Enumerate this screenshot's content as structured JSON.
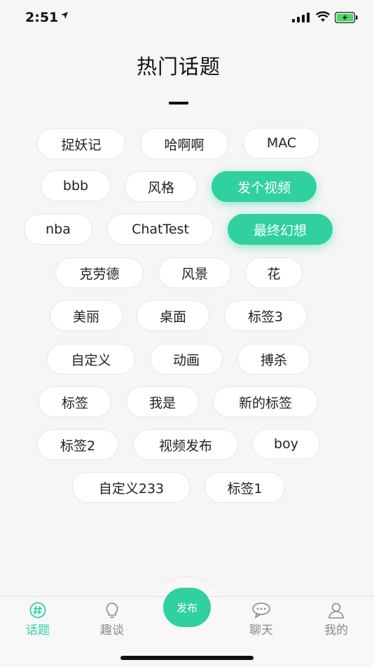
{
  "status": {
    "time": "2:51"
  },
  "page": {
    "title": "热门话题"
  },
  "tags": [
    {
      "label": "捉妖记",
      "active": false
    },
    {
      "label": "哈啊啊",
      "active": false
    },
    {
      "label": "MAC",
      "active": false
    },
    {
      "label": "bbb",
      "active": false
    },
    {
      "label": "风格",
      "active": false
    },
    {
      "label": "发个视频",
      "active": true
    },
    {
      "label": "nba",
      "active": false
    },
    {
      "label": "ChatTest",
      "active": false
    },
    {
      "label": "最终幻想",
      "active": true
    },
    {
      "label": "克劳德",
      "active": false
    },
    {
      "label": "风景",
      "active": false
    },
    {
      "label": "花",
      "active": false
    },
    {
      "label": "美丽",
      "active": false
    },
    {
      "label": "桌面",
      "active": false
    },
    {
      "label": "标签3",
      "active": false
    },
    {
      "label": "自定义",
      "active": false
    },
    {
      "label": "动画",
      "active": false
    },
    {
      "label": "搏杀",
      "active": false
    },
    {
      "label": "标签",
      "active": false
    },
    {
      "label": "我是",
      "active": false
    },
    {
      "label": "新的标签",
      "active": false
    },
    {
      "label": "标签2",
      "active": false
    },
    {
      "label": "视频发布",
      "active": false
    },
    {
      "label": "boy",
      "active": false
    },
    {
      "label": "自定义233",
      "active": false
    },
    {
      "label": "标签1",
      "active": false
    }
  ],
  "tabbar": {
    "topics": {
      "label": "话题",
      "icon": "hash-icon"
    },
    "chat_talk": {
      "label": "趣谈",
      "icon": "lightbulb-icon"
    },
    "publish": {
      "label": "发布"
    },
    "chat": {
      "label": "聊天",
      "icon": "chat-bubble-icon"
    },
    "mine": {
      "label": "我的",
      "icon": "user-icon"
    }
  },
  "colors": {
    "accent": "#31d0a1",
    "inactive": "#8a8a8a"
  }
}
